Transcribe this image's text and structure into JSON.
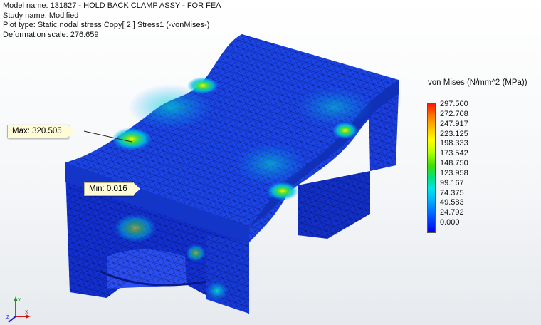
{
  "info": {
    "model_name": "Model name: 131827 - HOLD BACK CLAMP ASSY - FOR FEA",
    "study_name": "Study name: Modified",
    "plot_type": "Plot type: Static nodal stress Copy[ 2 ] Stress1 (-vonMises-)",
    "deformation_scale": "Deformation scale: 276.659"
  },
  "callouts": {
    "max_label": "Max: 320.505",
    "min_label": "Min: 0.016"
  },
  "legend": {
    "title": "von Mises (N/mm^2 (MPa))",
    "ticks": [
      "297.500",
      "272.708",
      "247.917",
      "223.125",
      "198.333",
      "173.542",
      "148.750",
      "123.958",
      "99.167",
      "74.375",
      "49.583",
      "24.792",
      "0.000"
    ],
    "colors": [
      "#ff1a00",
      "#ff7f00",
      "#ffc800",
      "#ffff00",
      "#b5ff00",
      "#3ae000",
      "#00e08a",
      "#00e6e6",
      "#00aaff",
      "#0050ff",
      "#0000f0"
    ]
  },
  "triad": {
    "labels": [
      "X",
      "Y",
      "Z"
    ]
  }
}
